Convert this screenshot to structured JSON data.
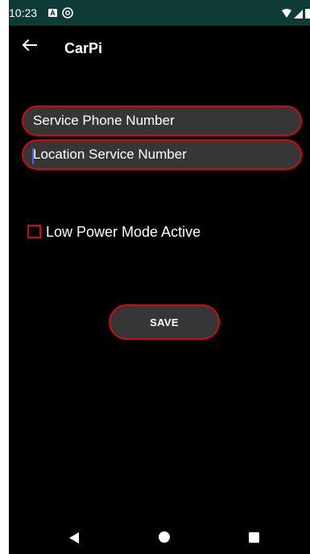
{
  "status_bar": {
    "time": "10:23",
    "icons": [
      "notification-a-icon",
      "at-sign-icon",
      "wifi-icon",
      "signal-icon",
      "battery-icon"
    ],
    "background_color": "#0e3b36"
  },
  "app_bar": {
    "title": "CarPi",
    "back_icon": "arrow-left-icon"
  },
  "form": {
    "service_phone_placeholder": "Service Phone Number",
    "service_phone_value": "",
    "location_service_placeholder": "Location Service Number",
    "location_service_value": "",
    "low_power_label": "Low Power Mode Active",
    "low_power_checked": false,
    "save_label": "SAVE"
  },
  "nav_bar": {
    "icons": [
      "nav-back-icon",
      "nav-home-icon",
      "nav-recents-icon"
    ]
  },
  "colors": {
    "accent_border": "#d00b0b",
    "field_background": "#363636",
    "cursor": "#4a63d9",
    "screen_background": "#000000"
  }
}
